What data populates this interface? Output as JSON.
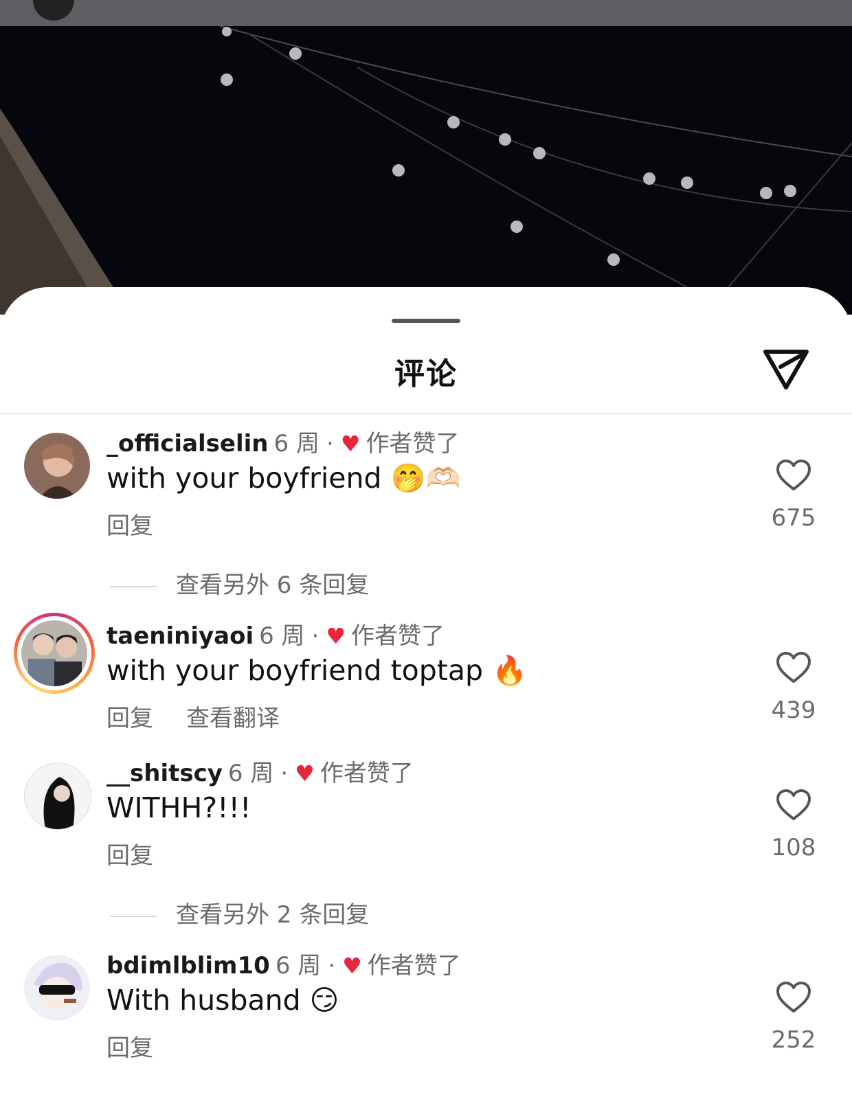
{
  "sheet": {
    "title": "评论"
  },
  "comments": [
    {
      "username": "_officialselin",
      "age": "6 周",
      "liked_label": "作者赞了",
      "text": "with your boyfriend 🤭🫶🏻",
      "reply_label": "回复",
      "translate_label": "",
      "likes": "675",
      "view_replies": "查看另外 6 条回复"
    },
    {
      "username": "taeniniyaoi",
      "age": "6 周",
      "liked_label": "作者赞了",
      "text": "with your boyfriend toptap 🔥",
      "reply_label": "回复",
      "translate_label": "查看翻译",
      "likes": "439",
      "view_replies": ""
    },
    {
      "username": "__shitscy",
      "age": "6 周",
      "liked_label": "作者赞了",
      "text": "WITHH?!!!",
      "reply_label": "回复",
      "translate_label": "",
      "likes": "108",
      "view_replies": "查看另外 2 条回复"
    },
    {
      "username": "bdimlblim10",
      "age": "6 周",
      "liked_label": "作者赞了",
      "text": "With husband 😏",
      "reply_label": "回复",
      "translate_label": "",
      "likes": "252",
      "view_replies": ""
    }
  ],
  "icons": {
    "send": "send-icon",
    "like": "heart-outline-icon",
    "author_like": "red-heart-icon"
  },
  "colors": {
    "author_heart": "#e8263b",
    "secondary_text": "#6b6b6b"
  }
}
